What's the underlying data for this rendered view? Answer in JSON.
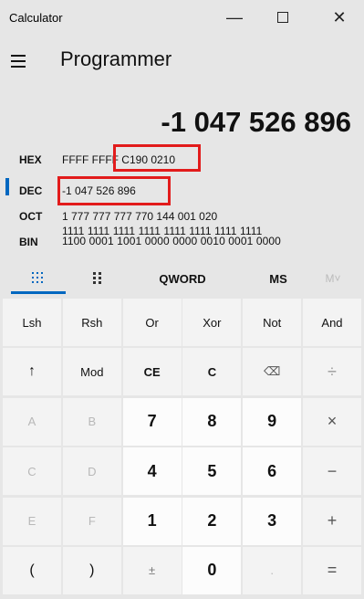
{
  "window": {
    "title": "Calculator"
  },
  "header": {
    "mode": "Programmer"
  },
  "display": {
    "value": "-1 047 526 896"
  },
  "radix": {
    "hex": {
      "label": "HEX",
      "value": "FFFF FFFF C190 0210"
    },
    "dec": {
      "label": "DEC",
      "value": "-1 047 526 896"
    },
    "oct": {
      "label": "OCT",
      "value": "1 777 777 777 770 144 001 020"
    },
    "bin": {
      "label": "BIN",
      "line1": "1111 1111 1111 1111 1111 1111 1111 1111",
      "line2": "1100 0001 1001 0000 0000 0010 0001 0000"
    }
  },
  "toolbar": {
    "word_size": "QWORD",
    "ms": "MS",
    "mplus": "M˅"
  },
  "keys": [
    [
      "Lsh",
      "Rsh",
      "Or",
      "Xor",
      "Not",
      "And"
    ],
    [
      "↑",
      "Mod",
      "CE",
      "C",
      "⌫",
      "÷"
    ],
    [
      "A",
      "B",
      "7",
      "8",
      "9",
      "×"
    ],
    [
      "C",
      "D",
      "4",
      "5",
      "6",
      "−"
    ],
    [
      "E",
      "F",
      "1",
      "2",
      "3",
      "+"
    ],
    [
      "(",
      ")",
      "±",
      "0",
      ".",
      "="
    ]
  ],
  "colors": {
    "accent": "#0067c0",
    "highlight": "#e21b1b",
    "background": "#e6e6e6"
  }
}
